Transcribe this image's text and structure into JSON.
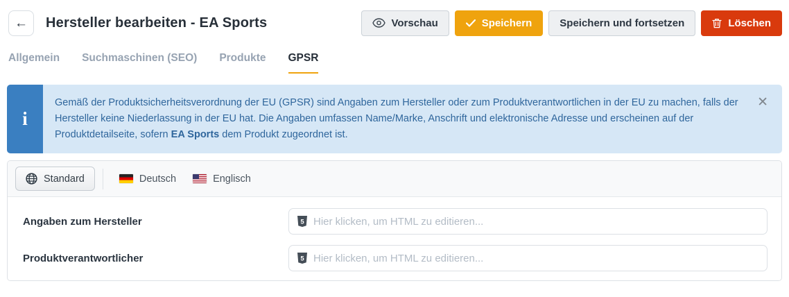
{
  "header": {
    "back_icon": "←",
    "title": "Hersteller bearbeiten - EA Sports",
    "buttons": {
      "preview": {
        "label": "Vorschau",
        "icon": "eye-icon"
      },
      "save": {
        "label": "Speichern",
        "icon": "check-icon",
        "color": "#efa30e"
      },
      "save_continue": {
        "label": "Speichern und fortsetzen"
      },
      "delete": {
        "label": "Löschen",
        "icon": "trash-icon",
        "color": "#d93a0d"
      }
    }
  },
  "tabs": [
    {
      "label": "Allgemein",
      "active": false
    },
    {
      "label": "Suchmaschinen (SEO)",
      "active": false
    },
    {
      "label": "Produkte",
      "active": false
    },
    {
      "label": "GPSR",
      "active": true
    }
  ],
  "alert": {
    "icon": "info-icon",
    "icon_glyph": "i",
    "text_before": "Gemäß der Produktsicherheitsverordnung der EU (GPSR) sind Angaben zum Hersteller oder zum Produktverantwortlichen in der EU zu machen, falls der Hersteller keine Niederlassung in der EU hat. Die Angaben umfassen Name/Marke, Anschrift und elektronische Adresse und erscheinen auf der Produktdetailseite, sofern",
    "brand": "EA Sports",
    "text_after": "dem Produkt zugeordnet ist.",
    "close_icon": "✕",
    "accent_color": "#3a7fc1",
    "background_color": "#d6e7f6",
    "text_color": "#2f669c"
  },
  "language_tabs": [
    {
      "label": "Standard",
      "icon": "globe-icon",
      "active": true
    },
    {
      "label": "Deutsch",
      "icon": "flag-de-icon",
      "active": false
    },
    {
      "label": "Englisch",
      "icon": "flag-us-icon",
      "active": false
    }
  ],
  "form": {
    "rows": [
      {
        "label": "Angaben zum Hersteller",
        "placeholder": "Hier klicken, um HTML zu editieren...",
        "editor_icon": "html5-icon"
      },
      {
        "label": "Produktverantwortlicher",
        "placeholder": "Hier klicken, um HTML zu editieren...",
        "editor_icon": "html5-icon"
      }
    ]
  },
  "colors": {
    "tab_active_underline": "#efa30e",
    "tab_inactive_text": "#97a3b2",
    "panel_border": "#dde1e6"
  }
}
